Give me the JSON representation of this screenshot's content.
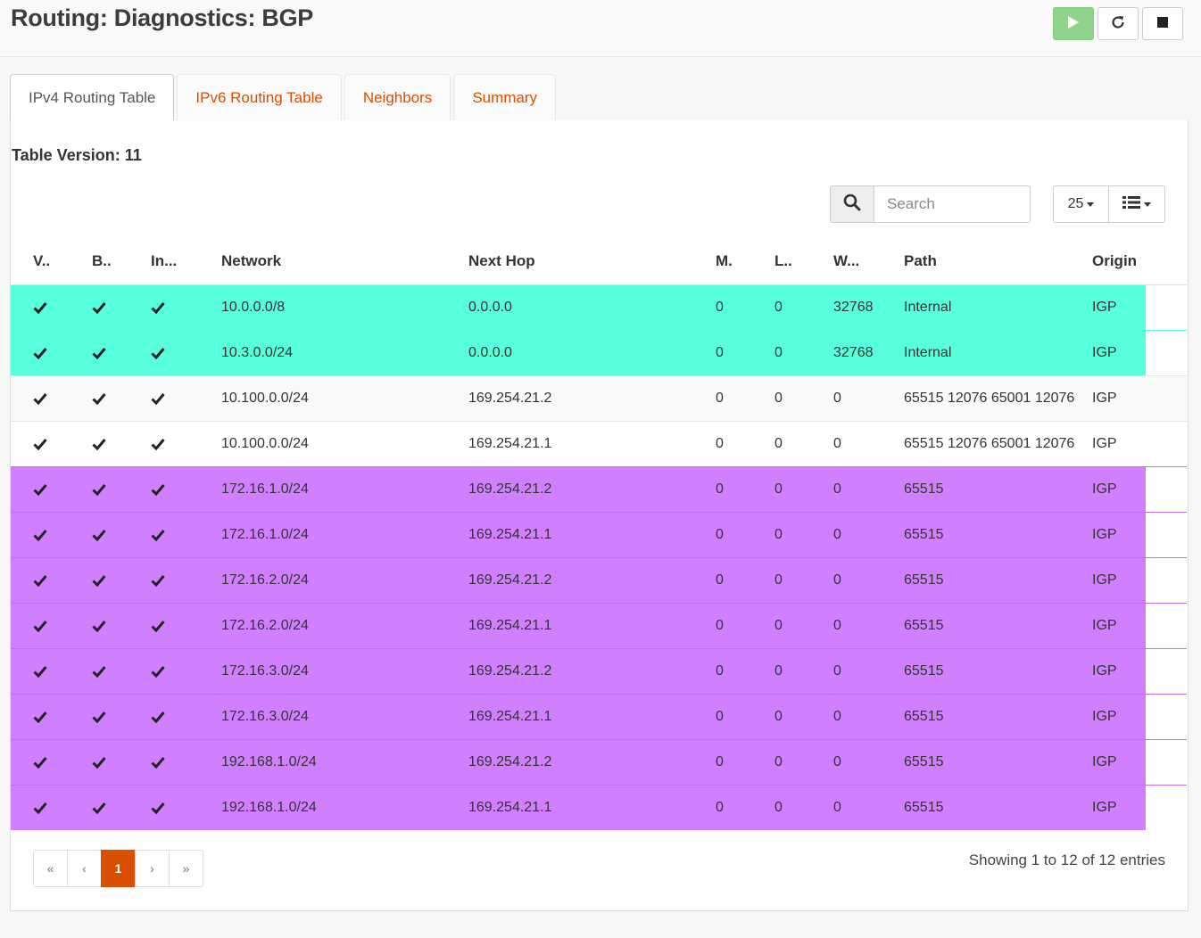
{
  "page": {
    "title": "Routing: Diagnostics: BGP"
  },
  "actions": [
    {
      "name": "play-icon",
      "label": "Play"
    },
    {
      "name": "refresh-icon",
      "label": "Refresh"
    },
    {
      "name": "stop-icon",
      "label": "Stop"
    }
  ],
  "tabs": [
    {
      "label": "IPv4 Routing Table",
      "active": true
    },
    {
      "label": "IPv6 Routing Table",
      "active": false
    },
    {
      "label": "Neighbors",
      "active": false
    },
    {
      "label": "Summary",
      "active": false
    }
  ],
  "table_version": "Table Version: 11",
  "search": {
    "placeholder": "Search",
    "value": ""
  },
  "rows_per_page": "25",
  "columns": [
    "V..",
    "B..",
    "In...",
    "Network",
    "Next Hop",
    "M.",
    "L..",
    "W...",
    "Path",
    "Origin"
  ],
  "rows": [
    {
      "valid": true,
      "best": true,
      "internal": true,
      "network": "10.0.0.0/8",
      "next_hop": "0.0.0.0",
      "metric": "0",
      "local_pref": "0",
      "weight": "32768",
      "path": "Internal",
      "origin": "IGP",
      "highlight": "cyan"
    },
    {
      "valid": true,
      "best": true,
      "internal": true,
      "network": "10.3.0.0/24",
      "next_hop": "0.0.0.0",
      "metric": "0",
      "local_pref": "0",
      "weight": "32768",
      "path": "Internal",
      "origin": "IGP",
      "highlight": "cyan"
    },
    {
      "valid": true,
      "best": true,
      "internal": true,
      "network": "10.100.0.0/24",
      "next_hop": "169.254.21.2",
      "metric": "0",
      "local_pref": "0",
      "weight": "0",
      "path": "65515 12076 65001 12076",
      "origin": "IGP",
      "highlight": ""
    },
    {
      "valid": true,
      "best": true,
      "internal": true,
      "network": "10.100.0.0/24",
      "next_hop": "169.254.21.1",
      "metric": "0",
      "local_pref": "0",
      "weight": "0",
      "path": "65515 12076 65001 12076",
      "origin": "IGP",
      "highlight": ""
    },
    {
      "valid": true,
      "best": true,
      "internal": true,
      "network": "172.16.1.0/24",
      "next_hop": "169.254.21.2",
      "metric": "0",
      "local_pref": "0",
      "weight": "0",
      "path": "65515",
      "origin": "IGP",
      "highlight": "purple"
    },
    {
      "valid": true,
      "best": true,
      "internal": true,
      "network": "172.16.1.0/24",
      "next_hop": "169.254.21.1",
      "metric": "0",
      "local_pref": "0",
      "weight": "0",
      "path": "65515",
      "origin": "IGP",
      "highlight": "purple"
    },
    {
      "valid": true,
      "best": true,
      "internal": true,
      "network": "172.16.2.0/24",
      "next_hop": "169.254.21.2",
      "metric": "0",
      "local_pref": "0",
      "weight": "0",
      "path": "65515",
      "origin": "IGP",
      "highlight": "purple"
    },
    {
      "valid": true,
      "best": true,
      "internal": true,
      "network": "172.16.2.0/24",
      "next_hop": "169.254.21.1",
      "metric": "0",
      "local_pref": "0",
      "weight": "0",
      "path": "65515",
      "origin": "IGP",
      "highlight": "purple"
    },
    {
      "valid": true,
      "best": true,
      "internal": true,
      "network": "172.16.3.0/24",
      "next_hop": "169.254.21.2",
      "metric": "0",
      "local_pref": "0",
      "weight": "0",
      "path": "65515",
      "origin": "IGP",
      "highlight": "purple"
    },
    {
      "valid": true,
      "best": true,
      "internal": true,
      "network": "172.16.3.0/24",
      "next_hop": "169.254.21.1",
      "metric": "0",
      "local_pref": "0",
      "weight": "0",
      "path": "65515",
      "origin": "IGP",
      "highlight": "purple"
    },
    {
      "valid": true,
      "best": true,
      "internal": true,
      "network": "192.168.1.0/24",
      "next_hop": "169.254.21.2",
      "metric": "0",
      "local_pref": "0",
      "weight": "0",
      "path": "65515",
      "origin": "IGP",
      "highlight": "purple"
    },
    {
      "valid": true,
      "best": true,
      "internal": true,
      "network": "192.168.1.0/24",
      "next_hop": "169.254.21.1",
      "metric": "0",
      "local_pref": "0",
      "weight": "0",
      "path": "65515",
      "origin": "IGP",
      "highlight": "purple"
    }
  ],
  "pagination": {
    "first": "«",
    "prev": "‹",
    "current": "1",
    "next": "›",
    "last": "»"
  },
  "info": "Showing 1 to 12 of 12 entries",
  "colors": {
    "accent": "#d94f00",
    "play_button": "#8fd48a",
    "highlight_cyan": "#58ffdd",
    "highlight_purple": "#d080ff"
  }
}
